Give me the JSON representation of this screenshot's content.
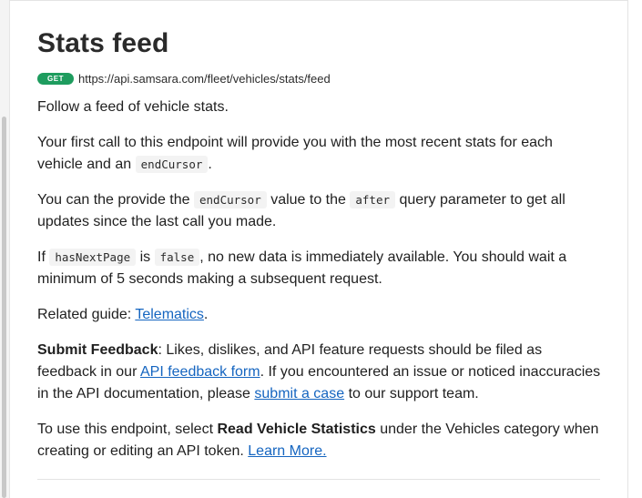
{
  "page": {
    "title": "Stats feed",
    "method": "GET",
    "endpoint_url": "https://api.samsara.com/fleet/vehicles/stats/feed"
  },
  "body": {
    "intro": "Follow a feed of vehicle stats.",
    "p2_text1": "Your first call to this endpoint will provide you with the most recent stats for each vehicle and an",
    "p2_code": "endCursor",
    "p2_text2": ".",
    "p3_text1": "You can the provide the",
    "p3_code1": "endCursor",
    "p3_text2": "value to the",
    "p3_code2": "after",
    "p3_text3": "query parameter to get all updates since the last call you made.",
    "p4_text1": "If",
    "p4_code1": "hasNextPage",
    "p4_text2": "is",
    "p4_code2": "false",
    "p4_text3": ", no new data is immediately available. You should wait a minimum of 5 seconds making a subsequent request.",
    "related_label": "Related guide:",
    "related_link": "Telematics",
    "related_end": ".",
    "feedback_bold": "Submit Feedback",
    "feedback_text1": ": Likes, dislikes, and API feature requests should be filed as feedback in our",
    "feedback_link1": "API feedback form",
    "feedback_text2": ". If you encountered an issue or noticed inaccuracies in the API documentation, please",
    "feedback_link2": "submit a case",
    "feedback_text3": "to our support team.",
    "usage_text1": "To use this endpoint, select",
    "usage_bold": "Read Vehicle Statistics",
    "usage_text2": "under the Vehicles category when creating or editing an API token.",
    "usage_link": "Learn More."
  },
  "colors": {
    "method_badge": "#1e9c5e",
    "link": "#1565c0",
    "code_bg": "#f3f3f3"
  }
}
